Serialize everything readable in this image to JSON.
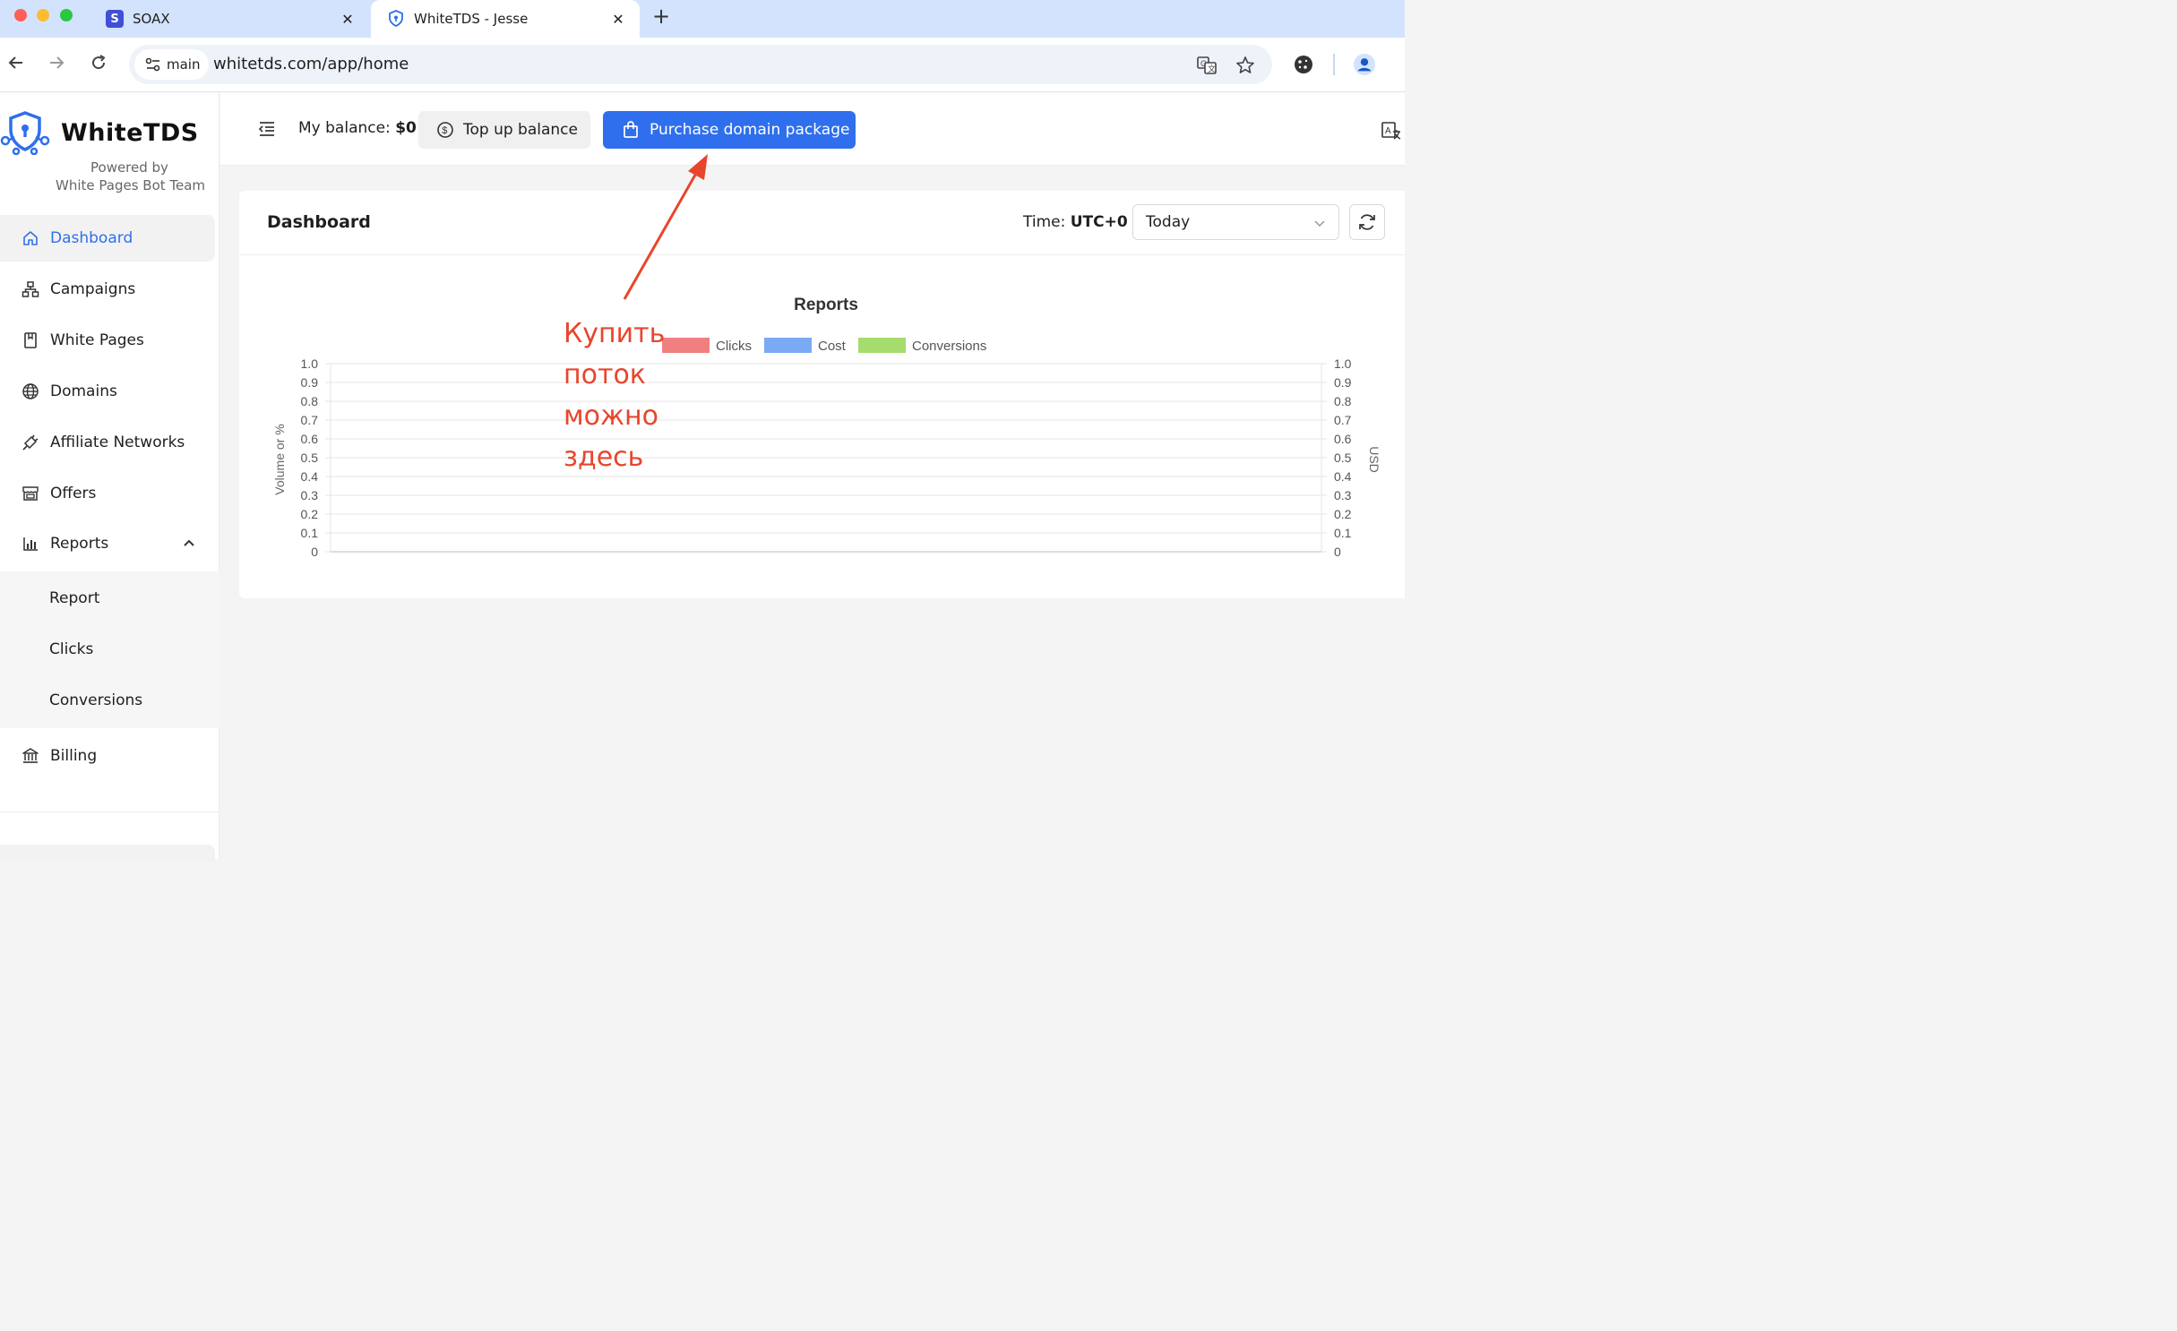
{
  "browser": {
    "tabs": [
      {
        "title": "SOAX",
        "favicon": "S",
        "favicon_color": "#3f4fd6"
      },
      {
        "title": "WhiteTDS - Jesse",
        "favicon": "whitetds-shield-icon",
        "favicon_color": "#2f6fed"
      }
    ],
    "profile_chip": "main",
    "url": "whitetds.com/app/home"
  },
  "brand": {
    "name": "WhiteTDS",
    "powered_line1": "Powered by",
    "powered_line2": "White Pages Bot Team",
    "accent": "#2f6fed"
  },
  "sidebar": {
    "items": [
      {
        "label": "Dashboard",
        "icon": "home-icon"
      },
      {
        "label": "Campaigns",
        "icon": "sitemap-icon"
      },
      {
        "label": "White Pages",
        "icon": "page-icon"
      },
      {
        "label": "Domains",
        "icon": "globe-icon"
      },
      {
        "label": "Affiliate Networks",
        "icon": "link-icon"
      },
      {
        "label": "Offers",
        "icon": "store-icon"
      },
      {
        "label": "Reports",
        "icon": "bar-chart-icon"
      }
    ],
    "reports_sub": [
      "Report",
      "Clicks",
      "Conversions"
    ],
    "billing": "Billing"
  },
  "header": {
    "balance_label": "My balance:",
    "balance_value": "$0",
    "topup": "Top up balance",
    "purchase": "Purchase domain package"
  },
  "dashboard": {
    "title": "Dashboard",
    "time_label": "Time:",
    "time_value": "UTC+0",
    "period": "Today"
  },
  "chart_data": {
    "type": "bar",
    "title": "Reports",
    "series": [
      {
        "name": "Clicks",
        "color": "#f08080",
        "values": []
      },
      {
        "name": "Cost",
        "color": "#7aaaf5",
        "values": []
      },
      {
        "name": "Conversions",
        "color": "#a6dc6e",
        "values": []
      }
    ],
    "ylabel": "Volume or %",
    "y2label": "USD",
    "ylim": [
      0,
      1.0
    ],
    "y2lim": [
      0,
      1.0
    ],
    "yticks": [
      "1.0",
      "0.9",
      "0.8",
      "0.7",
      "0.6",
      "0.5",
      "0.4",
      "0.3",
      "0.2",
      "0.1",
      "0"
    ],
    "grid": true,
    "legend": "top"
  },
  "annotation": {
    "lines": [
      "Купить",
      "поток",
      "можно",
      "здесь"
    ],
    "color": "#e8452c"
  }
}
